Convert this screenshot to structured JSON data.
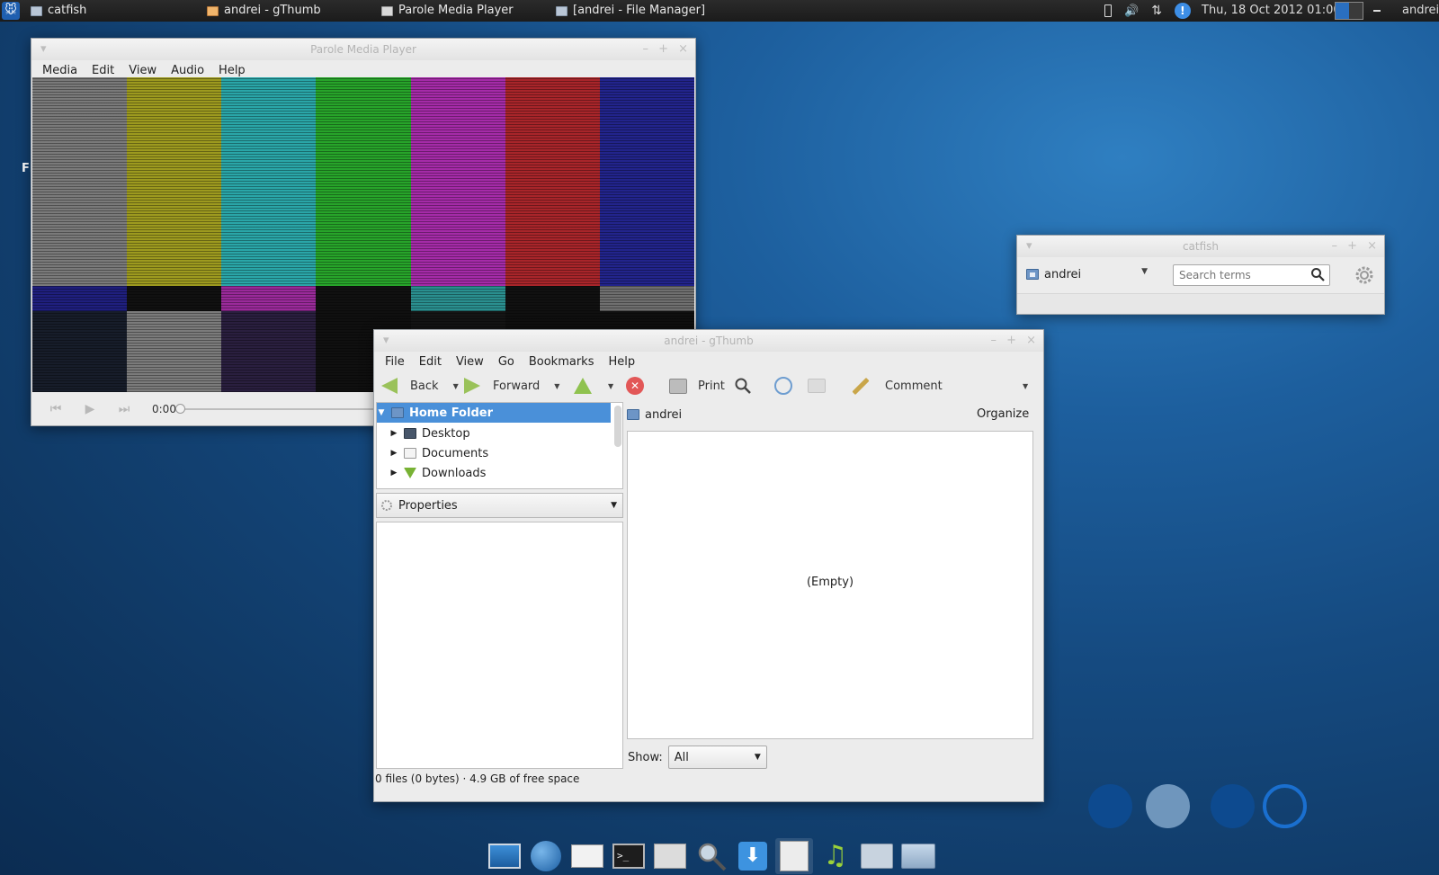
{
  "top_panel": {
    "tasks": [
      {
        "label": "catfish"
      },
      {
        "label": "andrei - gThumb"
      },
      {
        "label": "Parole Media Player"
      },
      {
        "label": "[andrei - File Manager]"
      }
    ],
    "clock": "Thu, 18 Oct 2012 01:00",
    "user": "andrei"
  },
  "desktop": {
    "partial_label": "Fi"
  },
  "parole": {
    "title": "Parole Media Player",
    "menu": [
      "Media",
      "Edit",
      "View",
      "Audio",
      "Help"
    ],
    "time": "0:00",
    "bar_colors": [
      "#7a7a7a",
      "#9d9a1f",
      "#2aa6a8",
      "#27a42a",
      "#a52ba8",
      "#a8252a",
      "#22248c"
    ],
    "strip_colors": [
      "#1f1f7e",
      "#111111",
      "#9a2a9a",
      "#111111",
      "#2a8f8f",
      "#111111",
      "#6f6f6f"
    ],
    "bottom_colors": [
      "#171d2a",
      "#7b7b7b",
      "#2a1f3f",
      "#101010",
      "#151515",
      "#101010",
      "#101010"
    ]
  },
  "catfish": {
    "title": "catfish",
    "location": "andrei",
    "search_placeholder": "Search terms"
  },
  "gthumb": {
    "title": "andrei - gThumb",
    "menu": [
      "File",
      "Edit",
      "View",
      "Go",
      "Bookmarks",
      "Help"
    ],
    "toolbar": {
      "back": "Back",
      "forward": "Forward",
      "print": "Print",
      "comment": "Comment"
    },
    "tree": [
      "Home Folder",
      "Desktop",
      "Documents",
      "Downloads"
    ],
    "properties": "Properties",
    "location": "andrei",
    "organize": "Organize",
    "empty": "(Empty)",
    "show_label": "Show:",
    "show_value": "All",
    "status": "0 files (0 bytes) · 4.9 GB of free space"
  },
  "workspaces": [
    {
      "color": "#0d4a8f"
    },
    {
      "color": "#8fb3d6"
    },
    {
      "color": "#0d4a8f"
    },
    {
      "color": "#1a6fcf"
    }
  ],
  "dock": [
    {
      "icon": "desktop-icon"
    },
    {
      "icon": "browser-globe-icon"
    },
    {
      "icon": "mail-icon"
    },
    {
      "icon": "terminal-icon"
    },
    {
      "icon": "settings-tools-icon"
    },
    {
      "icon": "search-icon"
    },
    {
      "icon": "download-icon"
    },
    {
      "icon": "text-editor-icon"
    },
    {
      "icon": "media-player-icon"
    },
    {
      "icon": "catfish-search-icon"
    },
    {
      "icon": "file-manager-icon"
    }
  ]
}
